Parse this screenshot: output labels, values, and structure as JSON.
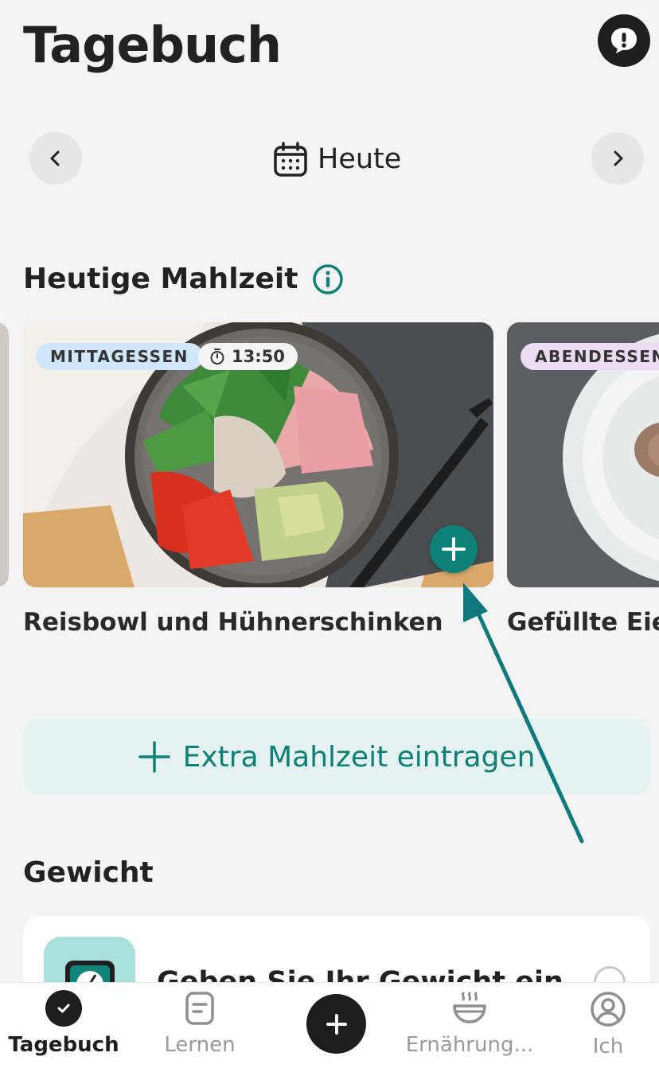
{
  "header": {
    "title": "Tagebuch",
    "feedback_icon": "exclamation-bubble-icon"
  },
  "date_nav": {
    "label": "Heute",
    "prev_icon": "chevron-left-icon",
    "next_icon": "chevron-right-icon",
    "calendar_icon": "calendar-icon"
  },
  "meals": {
    "heading": "Heutige Mahlzeit",
    "info_icon": "info-icon",
    "cards": [
      {
        "tag": "MITTAGESSEN",
        "time": "13:50",
        "name": "Reisbowl und Hühnerschinken",
        "tag_color": "#cfe6fb"
      },
      {
        "tag": "ABENDESSEN",
        "name": "Gefüllte Eier",
        "tag_color": "#ebdbf3"
      }
    ]
  },
  "extra_meal": {
    "label": "Extra Mahlzeit eintragen"
  },
  "weight": {
    "heading": "Gewicht",
    "prompt": "Geben Sie Ihr Gewicht ein"
  },
  "bottom_nav": {
    "items": [
      {
        "label": "Tagebuch",
        "icon": "check-circle-icon",
        "active": true
      },
      {
        "label": "Lernen",
        "icon": "document-icon"
      },
      {
        "label": "",
        "icon": "plus-icon"
      },
      {
        "label": "Ernährung...",
        "icon": "bowl-icon"
      },
      {
        "label": "Ich",
        "icon": "user-icon"
      }
    ]
  },
  "colors": {
    "accent": "#0e8276",
    "accent_light": "#e4f2f1",
    "background": "#f4f4f4"
  }
}
